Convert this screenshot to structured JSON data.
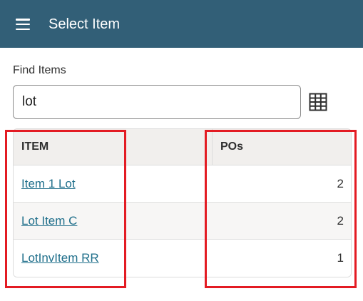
{
  "header": {
    "title": "Select Item",
    "menu_icon": "hamburger-menu-icon",
    "background": "#325f77"
  },
  "search": {
    "label": "Find Items",
    "value": "lot",
    "scan_icon": "grid-table-icon"
  },
  "table": {
    "columns": [
      "ITEM",
      "POs"
    ],
    "rows": [
      {
        "item": "Item 1 Lot",
        "pos": "2"
      },
      {
        "item": "Lot Item C",
        "pos": "2"
      },
      {
        "item": "LotInvItem RR",
        "pos": "1"
      }
    ]
  },
  "colors": {
    "link": "#1f6f8b",
    "highlight": "#e31b23"
  }
}
